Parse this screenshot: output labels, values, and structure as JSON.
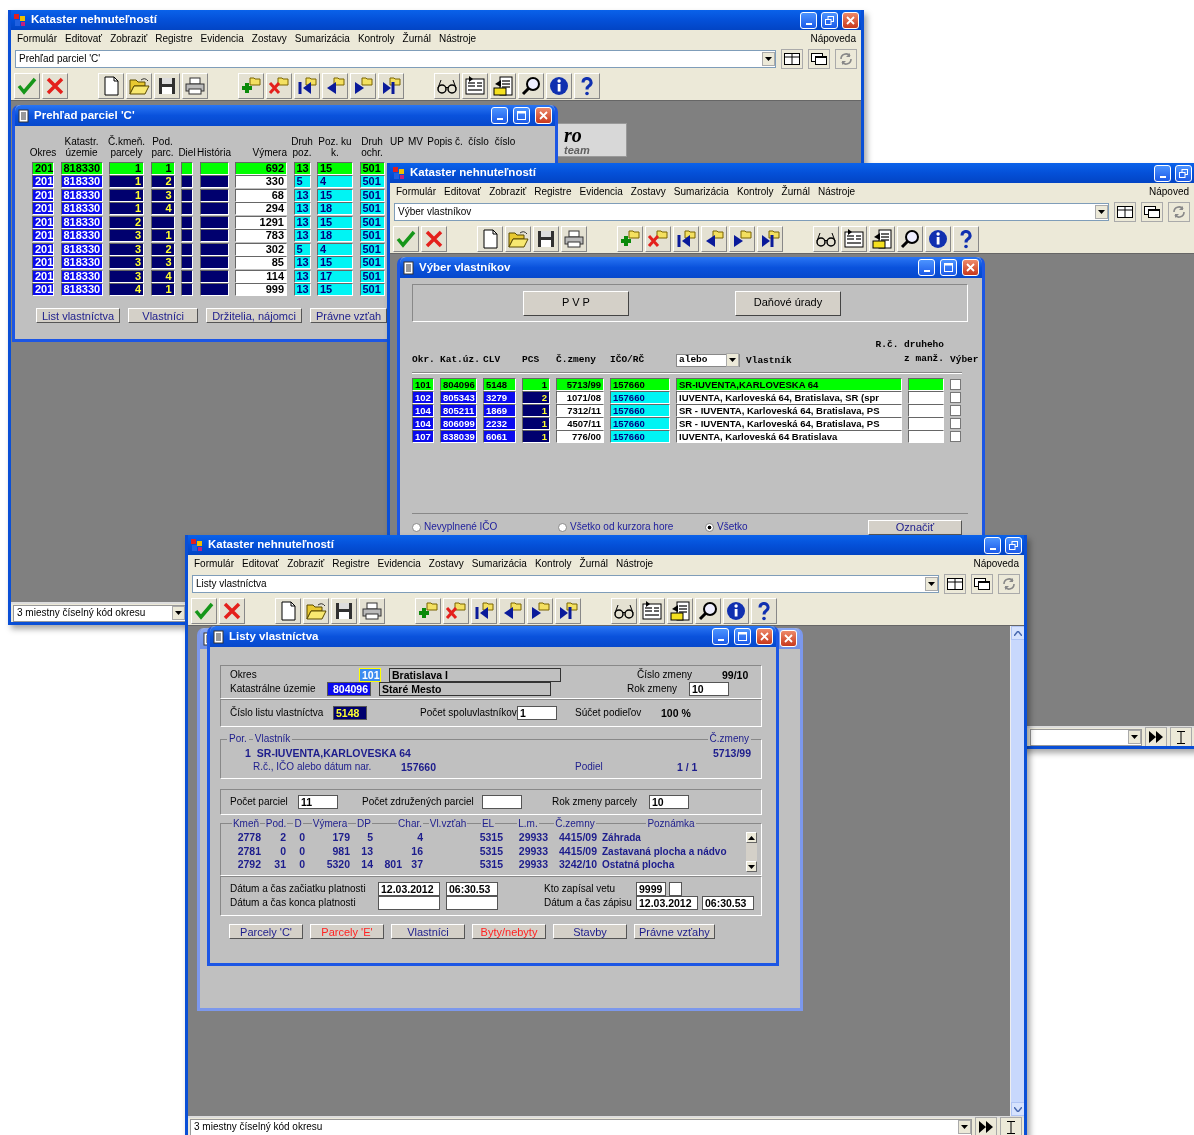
{
  "windows": [
    {
      "title": "Kataster nehnuteľností",
      "menu": [
        "Formulár",
        "Editovať",
        "Zobraziť",
        "Registre",
        "Evidencia",
        "Zostavy",
        "Sumarizácia",
        "Kontroly",
        "Žurnál",
        "Nástroje"
      ],
      "help": "Nápoveda",
      "combo": "Prehľad parciel 'C'",
      "status": "3 miestny číselný kód okresu",
      "logo": {
        "text": "ro",
        "subtitle": "team"
      },
      "child": {
        "kind": "parcel_list",
        "title": "Prehľad parciel 'C'",
        "columns": [
          {
            "label": "Okres",
            "kind": "key"
          },
          {
            "label": "Katastr. územie",
            "kind": "key"
          },
          {
            "label": "Č.kmeň. parcely",
            "kind": "num"
          },
          {
            "label": "Pod. parc.",
            "kind": "num"
          },
          {
            "label": "Diel",
            "kind": "num"
          },
          {
            "label": "História",
            "kind": "num"
          },
          {
            "label": "Výmera",
            "kind": "plain"
          },
          {
            "label": "Druh poz.",
            "kind": "code"
          },
          {
            "label": "Poz. ku k.",
            "kind": "code"
          },
          {
            "label": "Druh ochr.",
            "kind": "code"
          }
        ],
        "more_headers": [
          "UP",
          "MV",
          "Popis č.",
          "číslo",
          "číslo"
        ],
        "rows": [
          {
            "selected": true,
            "cells": [
              "201",
              "818330",
              "1",
              "1",
              null,
              null,
              "692",
              "13",
              "15",
              "501"
            ]
          },
          {
            "selected": false,
            "cells": [
              "201",
              "818330",
              "1",
              "2",
              null,
              null,
              "330",
              "5",
              "4",
              "501"
            ]
          },
          {
            "selected": false,
            "cells": [
              "201",
              "818330",
              "1",
              "3",
              null,
              null,
              "68",
              "13",
              "15",
              "501"
            ]
          },
          {
            "selected": false,
            "cells": [
              "201",
              "818330",
              "1",
              "4",
              null,
              null,
              "294",
              "13",
              "18",
              "501"
            ]
          },
          {
            "selected": false,
            "cells": [
              "201",
              "818330",
              "2",
              null,
              null,
              null,
              "1291",
              "13",
              "15",
              "501"
            ]
          },
          {
            "selected": false,
            "cells": [
              "201",
              "818330",
              "3",
              "1",
              null,
              null,
              "783",
              "13",
              "18",
              "501"
            ]
          },
          {
            "selected": false,
            "cells": [
              "201",
              "818330",
              "3",
              "2",
              null,
              null,
              "302",
              "5",
              "4",
              "501"
            ]
          },
          {
            "selected": false,
            "cells": [
              "201",
              "818330",
              "3",
              "3",
              null,
              null,
              "85",
              "13",
              "15",
              "501"
            ]
          },
          {
            "selected": false,
            "cells": [
              "201",
              "818330",
              "3",
              "4",
              null,
              null,
              "114",
              "13",
              "17",
              "501"
            ]
          },
          {
            "selected": false,
            "cells": [
              "201",
              "818330",
              "4",
              "1",
              null,
              null,
              "999",
              "13",
              "15",
              "501"
            ]
          }
        ],
        "buttons": [
          "List vlastníctva",
          "Vlastníci",
          "Držitelia, nájomci",
          "Právne vzťah"
        ]
      }
    },
    {
      "title": "Kataster nehnuteľností",
      "menu": [
        "Formulár",
        "Editovať",
        "Zobraziť",
        "Registre",
        "Evidencia",
        "Zostavy",
        "Sumarizácia",
        "Kontroly",
        "Žurnál",
        "Nástroje"
      ],
      "help": "Nápoved",
      "combo": "Výber vlastníkov",
      "child": {
        "kind": "owner_select",
        "title": "Výber vlastníkov",
        "top_buttons": [
          "P V P",
          "Daňové úrady"
        ],
        "filter": "alebo",
        "columns": [
          {
            "label": "Okr.",
            "kind": "key"
          },
          {
            "label": "Kat.úz.",
            "kind": "key"
          },
          {
            "label": "CLV",
            "kind": "key"
          },
          {
            "label": "PCS",
            "kind": "num"
          },
          {
            "label": "Č.zmeny",
            "kind": "plain"
          },
          {
            "label": "IČO/RČ",
            "kind": "code"
          },
          {
            "label": "Vlastník",
            "kind": "text"
          },
          {
            "label": "R.č. druheho z manž.",
            "kind": "text"
          },
          {
            "label": "Výber",
            "kind": "check"
          }
        ],
        "rows": [
          {
            "selected": true,
            "checked": false,
            "cells": [
              "101",
              "804096",
              "5148",
              "1",
              "5713/99",
              "157660",
              "SR-IUVENTA,KARLOVESKA 64",
              null
            ]
          },
          {
            "selected": false,
            "checked": false,
            "cells": [
              "102",
              "805343",
              "3279",
              "2",
              "1071/08",
              "157660",
              "IUVENTA, Karloveská 64, Bratislava, SR (spr",
              null
            ]
          },
          {
            "selected": false,
            "checked": false,
            "cells": [
              "104",
              "805211",
              "1869",
              "1",
              "7312/11",
              "157660",
              "SR - IUVENTA, Karloveská 64, Bratislava, PS",
              null
            ]
          },
          {
            "selected": false,
            "checked": false,
            "cells": [
              "104",
              "806099",
              "2232",
              "1",
              "4507/11",
              "157660",
              "SR - IUVENTA, Karloveská 64, Bratislava, PS",
              null
            ]
          },
          {
            "selected": false,
            "checked": false,
            "cells": [
              "107",
              "838039",
              "6061",
              "1",
              "776/00",
              "157660",
              "IUVENTA, Karloveská 64 Bratislava",
              null
            ]
          }
        ],
        "radios": [
          {
            "label": "Nevyplnené IČO",
            "selected": false
          },
          {
            "label": "Všetko od kurzora hore",
            "selected": false
          },
          {
            "label": "Všetko",
            "selected": true
          }
        ],
        "action": "Označiť"
      }
    },
    {
      "title": "Kataster nehnuteľností",
      "menu": [
        "Formulár",
        "Editovať",
        "Zobraziť",
        "Registre",
        "Evidencia",
        "Zostavy",
        "Sumarizácia",
        "Kontroly",
        "Žurnál",
        "Nástroje"
      ],
      "help": "Nápoveda",
      "combo": "Listy vlastníctva",
      "status": "3 miestny číselný kód okresu",
      "child": {
        "kind": "ownership_sheet",
        "title": "Listy vlastníctva",
        "district": {
          "label": "Okres",
          "code": "101",
          "name": "Bratislava I"
        },
        "cadastre": {
          "label": "Katastrálne územie",
          "code": "804096",
          "name": "Staré Mesto"
        },
        "change_no": {
          "label": "Číslo zmeny",
          "value": "99/10"
        },
        "change_year": {
          "label": "Rok zmeny",
          "value": "10"
        },
        "sheet_no": {
          "label": "Číslo listu vlastníctva",
          "value": "5148"
        },
        "co_owners": {
          "label": "Počet spoluvlastníkov",
          "value": "1"
        },
        "share_sum": {
          "label": "Súčet podieľov",
          "value": "100 %"
        },
        "owner": {
          "legend": [
            "Por.",
            "Vlastník",
            "Č.zmeny"
          ],
          "order": "1",
          "name": "SR-IUVENTA,KARLOVESKA 64",
          "change": "5713/99",
          "id_label": "R.č., IČO alebo dátum nar.",
          "id": "157660",
          "share_label": "Podiel",
          "share": "1 / 1"
        },
        "counts": [
          {
            "label": "Počet parciel",
            "value": "11"
          },
          {
            "label": "Počet združených parciel"
          },
          {
            "label": "Rok zmeny parcely",
            "value": "10"
          }
        ],
        "parcels": {
          "columns": [
            "Kmeň",
            "Pod.",
            "D",
            "Výmera",
            "DP",
            null,
            "Char.",
            "Vl.vzťah",
            "EL",
            "L.m.",
            "Č.zemny",
            "Poznámka"
          ],
          "rows": [
            [
              "2778",
              "2",
              "0",
              "179",
              "5",
              null,
              "4",
              null,
              "5315",
              "29933",
              "4415/09",
              "Záhrada"
            ],
            [
              "2781",
              "0",
              "0",
              "981",
              "13",
              null,
              "16",
              null,
              "5315",
              "29933",
              "4415/09",
              "Zastavaná plocha a nádvo"
            ],
            [
              "2792",
              "31",
              "0",
              "5320",
              "14",
              "801",
              "37",
              null,
              "5315",
              "29933",
              "3242/10",
              "Ostatná plocha"
            ]
          ]
        },
        "validity": [
          {
            "label": "Dátum a čas začiatku platnosti",
            "date": "12.03.2012",
            "time": "06:30.53"
          },
          {
            "label": "Dátum a čas konca platnosti"
          }
        ],
        "writer": {
          "label": "Kto zapísal vetu",
          "value": "9999"
        },
        "written": {
          "label": "Dátum a čas zápisu",
          "date": "12.03.2012",
          "time": "06:30.53"
        },
        "buttons": [
          {
            "label": "Parcely 'C'",
            "color": "#1c1c8c"
          },
          {
            "label": "Parcely 'E'",
            "color": "#ff2222"
          },
          {
            "label": "Vlastníci",
            "color": "#1c1c8c"
          },
          {
            "label": "Byty/nebyty",
            "color": "#ff2222"
          },
          {
            "label": "Stavby",
            "color": "#1c1c8c"
          },
          {
            "label": "Právne vzťahy",
            "color": "#1c1c8c"
          }
        ]
      }
    }
  ]
}
